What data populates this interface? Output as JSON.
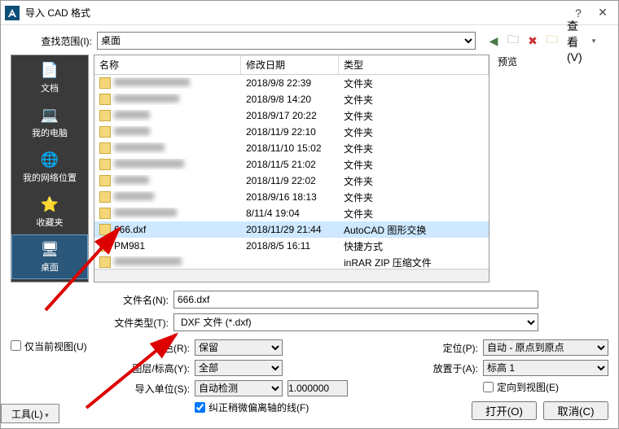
{
  "title": "导入 CAD 格式",
  "lookin_label": "查找范围(I):",
  "lookin_value": "桌面",
  "toolbar": {
    "view_label": "查看(V)"
  },
  "preview_label": "预览",
  "places": [
    {
      "label": "文档",
      "icon": "📄"
    },
    {
      "label": "我的电脑",
      "icon": "💻"
    },
    {
      "label": "我的网络位置",
      "icon": "🌐"
    },
    {
      "label": "收藏夹",
      "icon": "⭐"
    },
    {
      "label": "桌面",
      "icon": "🖥"
    },
    {
      "label": "",
      "icon": "📁"
    }
  ],
  "columns": {
    "name": "名称",
    "date": "修改日期",
    "type": "类型"
  },
  "rows": [
    {
      "name": "",
      "date": "2018/9/8 22:39",
      "type": "文件夹",
      "blur": true
    },
    {
      "name": "",
      "date": "2018/9/8 14:20",
      "type": "文件夹",
      "blur": true
    },
    {
      "name": "",
      "date": "2018/9/17 20:22",
      "type": "文件夹",
      "blur": true
    },
    {
      "name": "",
      "date": "2018/11/9 22:10",
      "type": "文件夹",
      "blur": true
    },
    {
      "name": "",
      "date": "2018/11/10 15:02",
      "type": "文件夹",
      "blur": true
    },
    {
      "name": "",
      "date": "2018/11/5 21:02",
      "type": "文件夹",
      "blur": true
    },
    {
      "name": "",
      "date": "2018/11/9 22:02",
      "type": "文件夹",
      "blur": true
    },
    {
      "name": "",
      "date": "2018/9/16 18:13",
      "type": "文件夹",
      "blur": true
    },
    {
      "name": "",
      "date": "8/11/4 19:04",
      "type": "文件夹",
      "blur": true
    },
    {
      "name": "666.dxf",
      "date": "2018/11/29 21:44",
      "type": "AutoCAD 图形交换",
      "selected": true
    },
    {
      "name": "PM981",
      "date": "2018/8/5 16:11",
      "type": "快捷方式"
    },
    {
      "name": "",
      "date": "",
      "type": "inRAR ZIP 压缩文件",
      "blur": true
    }
  ],
  "filename_label": "文件名(N):",
  "filename_value": "666.dxf",
  "filetype_label": "文件类型(T):",
  "filetype_value": "DXF 文件 (*.dxf)",
  "current_view_only": "仅当前视图(U)",
  "color_label": "颜色(R):",
  "color_value": "保留",
  "layers_label": "图层/标高(Y):",
  "layers_value": "全部",
  "units_label": "导入单位(S):",
  "units_value": "自动检测",
  "units_number": "1.000000",
  "pos_label": "定位(P):",
  "pos_value": "自动 - 原点到原点",
  "place_label": "放置于(A):",
  "place_value": "标高 1",
  "orient_to_view": "定向到视图(E)",
  "correct_lines": "纠正稍微偏离轴的线(F)",
  "tools": "工具(L)",
  "open": "打开(O)",
  "cancel": "取消(C)"
}
